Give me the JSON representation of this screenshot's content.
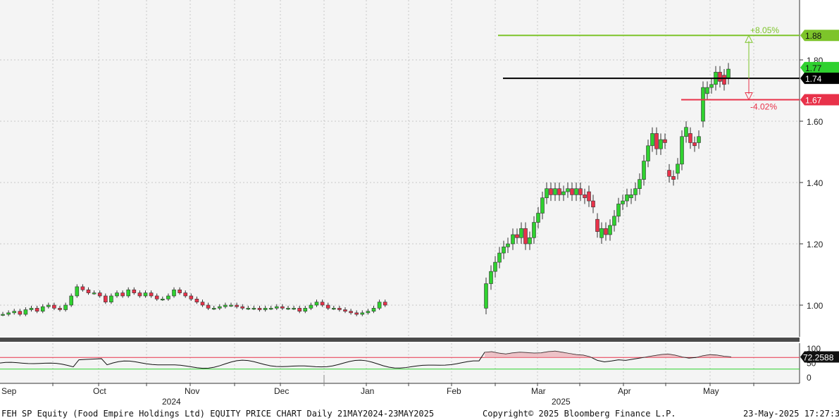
{
  "chart_data": {
    "type": "candlestick",
    "security": "FEH SP Equity",
    "main_panel": {
      "y_ticks": [
        1.0,
        1.2,
        1.4,
        1.6,
        1.8
      ],
      "ylim": [
        0.9,
        1.98
      ],
      "x_month_labels": [
        "Sep",
        "Oct",
        "Nov",
        "Dec",
        "Jan",
        "Feb",
        "Mar",
        "Apr",
        "May"
      ],
      "x_year_labels": [
        "2024",
        "2025"
      ],
      "price_tags": [
        {
          "label": "1.88",
          "value": 1.88,
          "color": "#7dc42a"
        },
        {
          "label": "1.77",
          "value": 1.775,
          "color": "#2fd12f"
        },
        {
          "label": "1.74",
          "value": 1.74,
          "color": "#000000"
        },
        {
          "label": "1.67",
          "value": 1.67,
          "color": "#e8324a"
        }
      ],
      "horizontal_lines": [
        {
          "value": 1.88,
          "color": "#7dc42a"
        },
        {
          "value": 1.74,
          "color": "#000000"
        },
        {
          "value": 1.67,
          "color": "#e8324a"
        }
      ],
      "annotations": [
        {
          "text": "+8.05%",
          "color": "#7dc42a"
        },
        {
          "text": "-4.02%",
          "color": "#e8324a"
        }
      ]
    },
    "rsi_panel": {
      "value_label": "72.2588",
      "y_ticks": [
        "100",
        "50",
        "0"
      ],
      "overbought": 70,
      "oversold": 30
    },
    "colors": {
      "up": "#2fd12f",
      "down": "#e8324a",
      "background": "#f4f4f4"
    }
  },
  "footer": {
    "title": "FEH SP Equity (Food Empire Holdings Ltd) EQUITY PRICE CHART  Daily 21MAY2024-23MAY2025",
    "copyright": "Copyright© 2025 Bloomberg Finance L.P.",
    "timestamp": "23-May-2025 17:27:33"
  }
}
